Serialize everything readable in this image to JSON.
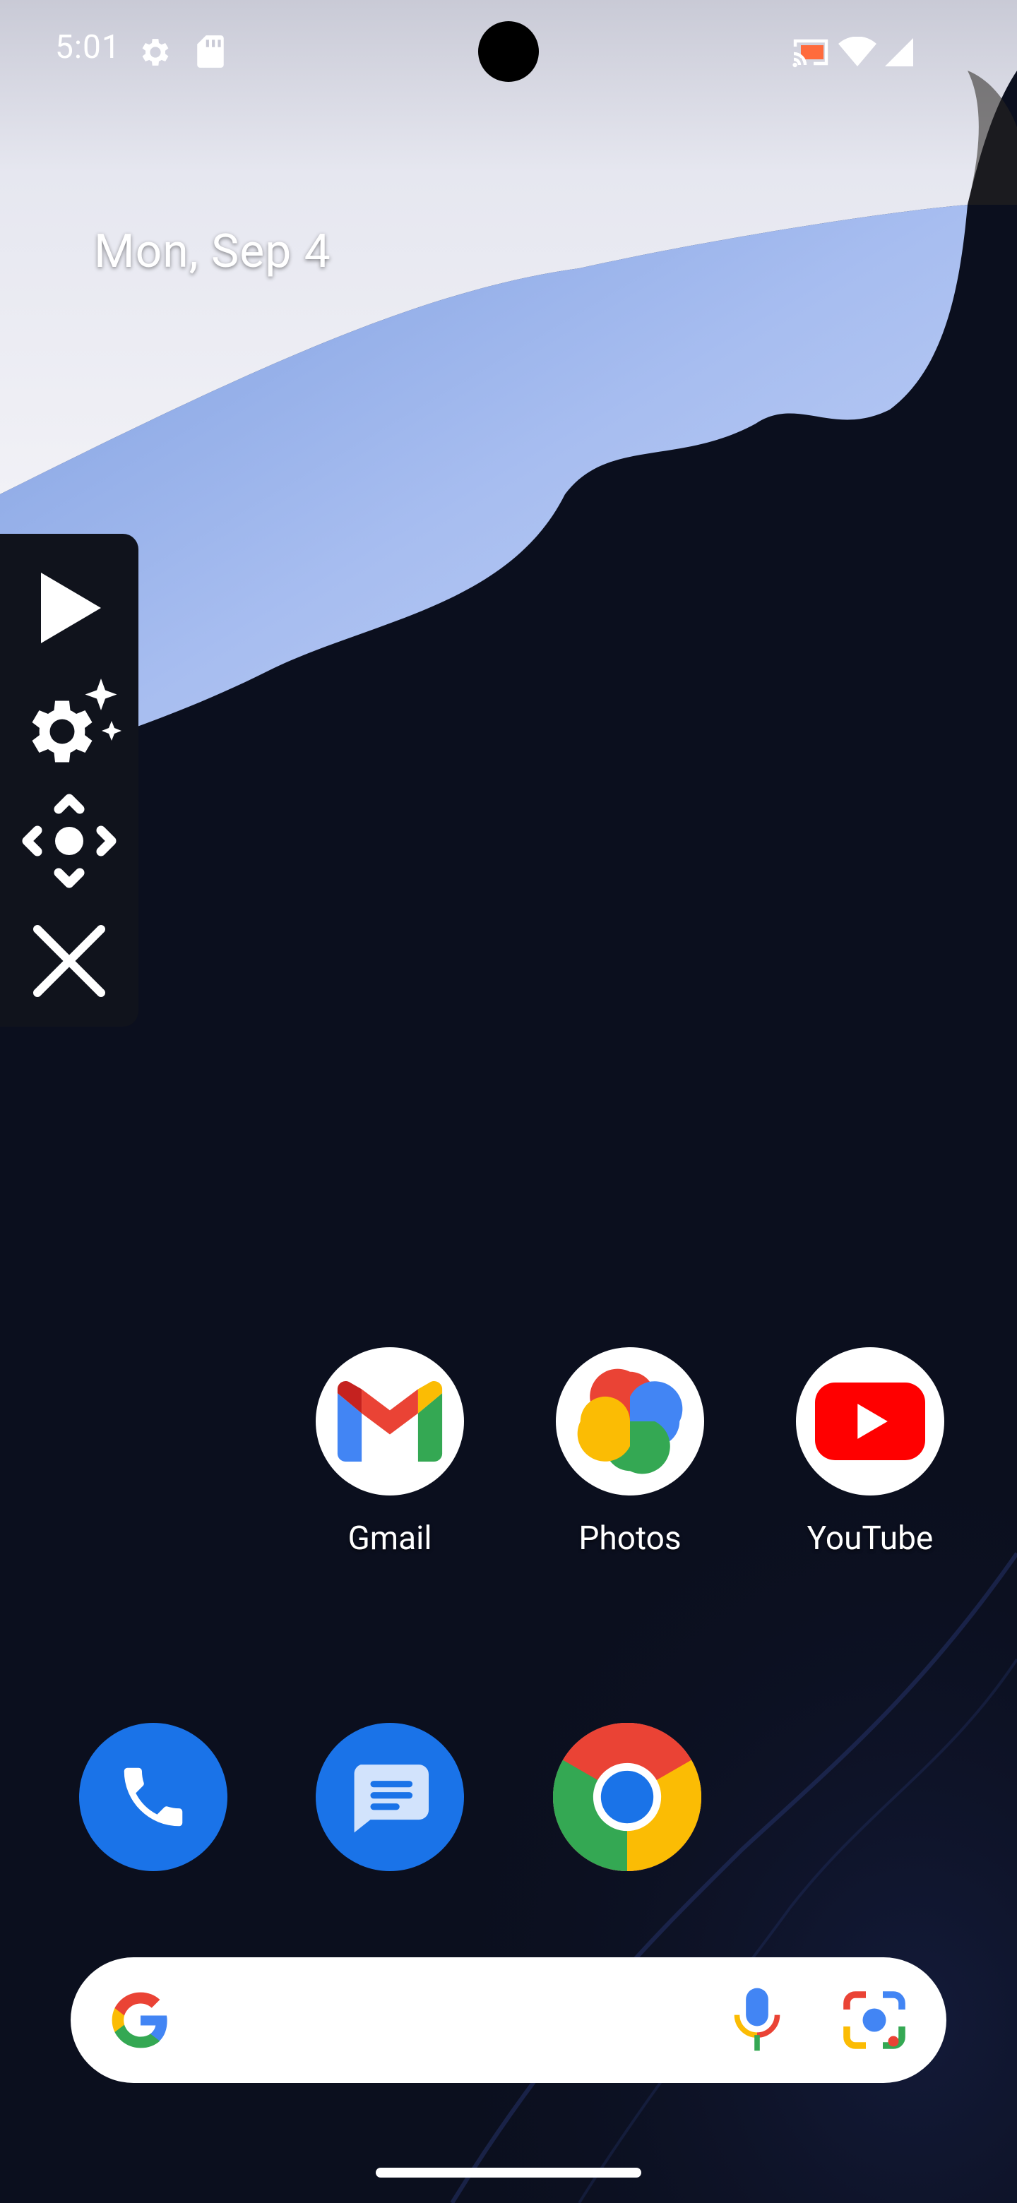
{
  "status_bar": {
    "time": "5:01",
    "left_icons": [
      "settings-gear-icon",
      "sd-card-icon"
    ],
    "right_icons": [
      "cast-icon",
      "wifi-icon",
      "cell-signal-icon"
    ]
  },
  "home": {
    "date": "Mon, Sep 4"
  },
  "floating_toolbar": {
    "buttons": [
      "play-icon",
      "settings-sparkle-icon",
      "move-icon",
      "close-icon"
    ]
  },
  "apps": [
    {
      "label": "Gmail",
      "icon": "gmail-icon"
    },
    {
      "label": "Photos",
      "icon": "photos-icon"
    },
    {
      "label": "YouTube",
      "icon": "youtube-icon"
    }
  ],
  "dock": [
    {
      "icon": "phone-icon",
      "color": "#1a73e8"
    },
    {
      "icon": "messages-icon",
      "color": "#1a73e8"
    },
    {
      "icon": "chrome-icon",
      "color": "#ffffff"
    }
  ],
  "search_bar": {
    "icons": [
      "google-g-icon",
      "microphone-icon",
      "google-lens-icon"
    ]
  },
  "colors": {
    "background": "#0b0f1e",
    "wallpaper_light": "#e8e9f2",
    "wallpaper_blue": "#9fb6ea",
    "toolbar_bg": "#10131c"
  }
}
